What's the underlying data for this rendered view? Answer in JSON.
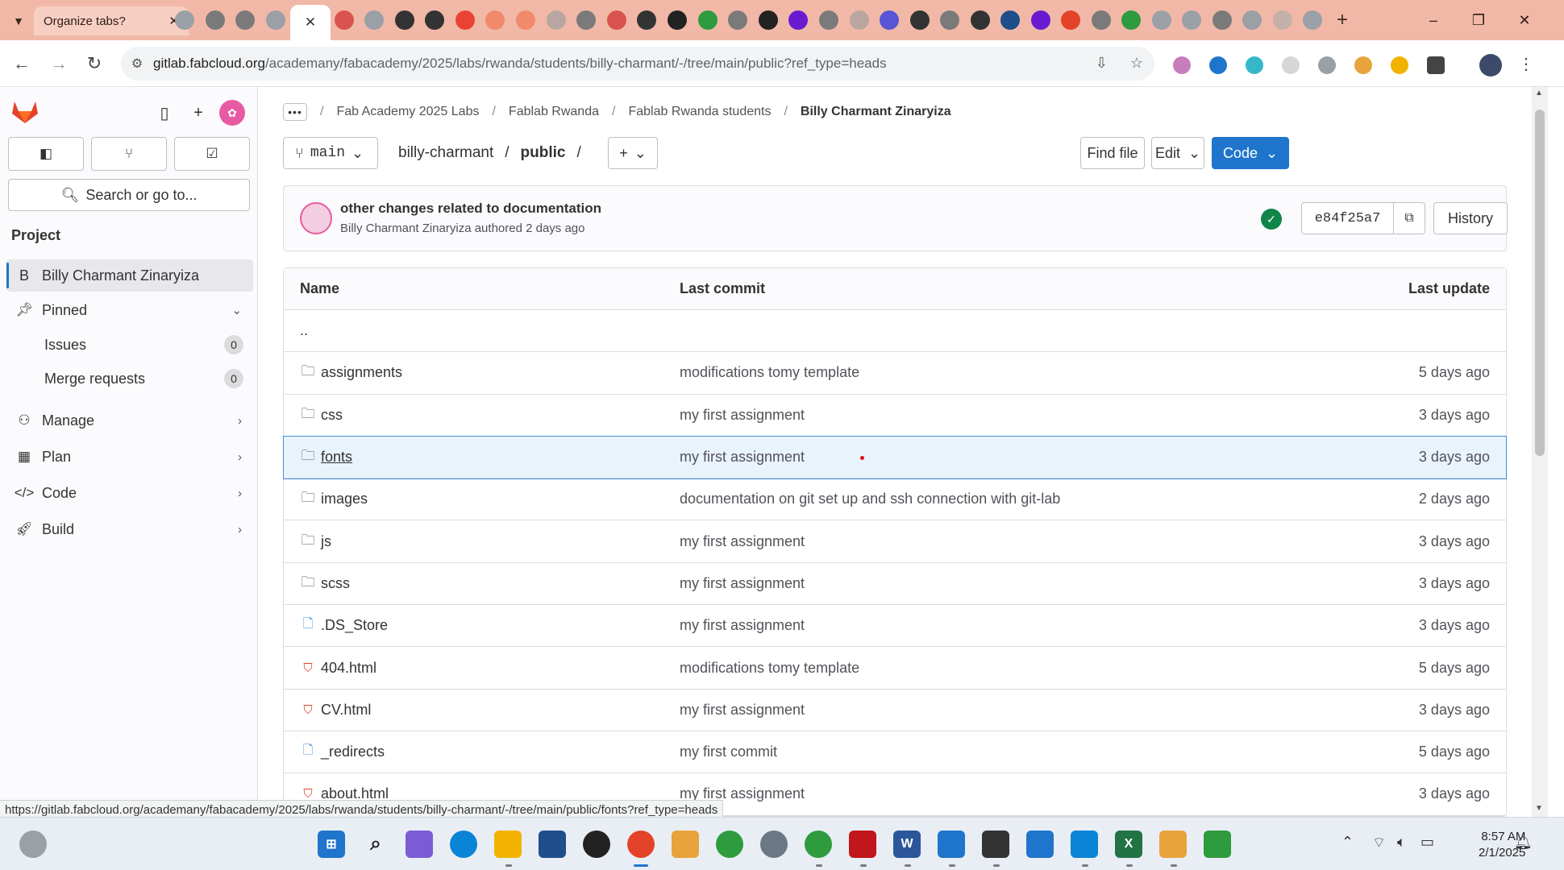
{
  "browser": {
    "tab_title": "Organize tabs?",
    "tab_close": "✕",
    "active_tab_close": "✕",
    "new_tab": "+",
    "url_host": "gitlab.fabcloud.org",
    "url_path": "/academany/fabacademy/2025/labs/rwanda/students/billy-charmant/-/tree/main/public?ref_type=heads",
    "status_url": "https://gitlab.fabcloud.org/academany/fabacademy/2025/labs/rwanda/students/billy-charmant/-/tree/main/public/fonts?ref_type=heads",
    "window_controls": [
      "–",
      "❐",
      "✕"
    ]
  },
  "sidebar": {
    "search_label": "Search or go to...",
    "section_title": "Project",
    "project_letter": "B",
    "project_name": "Billy Charmant Zinaryiza",
    "items": [
      {
        "label": "Pinned",
        "icon": "pin-icon"
      },
      {
        "label": "Issues",
        "count": "0"
      },
      {
        "label": "Merge requests",
        "count": "0"
      },
      {
        "label": "Manage",
        "icon": "users-icon"
      },
      {
        "label": "Plan",
        "icon": "calendar-icon"
      },
      {
        "label": "Code",
        "icon": "code-icon"
      },
      {
        "label": "Build",
        "icon": "rocket-icon"
      }
    ]
  },
  "breadcrumbs": [
    "Fab Academy 2025 Labs",
    "Fablab Rwanda",
    "Fablab Rwanda students",
    "Billy Charmant Zinaryiza"
  ],
  "repo": {
    "branch": "main",
    "path_root": "billy-charmant",
    "path_current": "public",
    "find_file": "Find file",
    "edit": "Edit",
    "code": "Code"
  },
  "commit": {
    "title": "other changes related to documentation",
    "author": "Billy Charmant Zinaryiza",
    "authored_text": "authored 2 days ago",
    "sha": "e84f25a7",
    "history": "History"
  },
  "table": {
    "headers": {
      "name": "Name",
      "last_commit": "Last commit",
      "last_update": "Last update"
    },
    "parent": "..",
    "rows": [
      {
        "name": "assignments",
        "type": "folder",
        "commit": "modifications tomy template",
        "date": "5 days ago"
      },
      {
        "name": "css",
        "type": "folder",
        "commit": "my first assignment",
        "date": "3 days ago"
      },
      {
        "name": "fonts",
        "type": "folder",
        "commit": "my first assignment",
        "date": "3 days ago"
      },
      {
        "name": "images",
        "type": "folder",
        "commit": "documentation on git set up and ssh connection with git-lab",
        "date": "2 days ago"
      },
      {
        "name": "js",
        "type": "folder",
        "commit": "my first assignment",
        "date": "3 days ago"
      },
      {
        "name": "scss",
        "type": "folder",
        "commit": "my first assignment",
        "date": "3 days ago"
      },
      {
        "name": ".DS_Store",
        "type": "file",
        "commit": "my first assignment",
        "date": "3 days ago"
      },
      {
        "name": "404.html",
        "type": "html",
        "commit": "modifications tomy template",
        "date": "5 days ago"
      },
      {
        "name": "CV.html",
        "type": "html",
        "commit": "my first assignment",
        "date": "3 days ago"
      },
      {
        "name": "_redirects",
        "type": "file",
        "commit": "my first commit",
        "date": "5 days ago"
      },
      {
        "name": "about.html",
        "type": "html",
        "commit": "my first assignment",
        "date": "3 days ago"
      }
    ]
  },
  "taskbar": {
    "time": "8:57 AM",
    "date": "2/1/2025"
  },
  "colors": {
    "tabstrip": "#f2b8a7",
    "primary": "#1f75cb",
    "success": "#108548",
    "html_icon": "#e24329"
  }
}
